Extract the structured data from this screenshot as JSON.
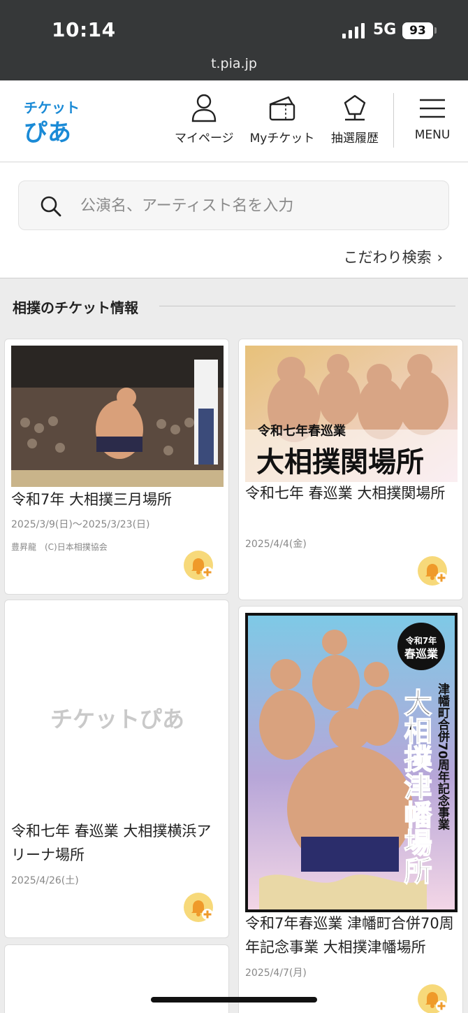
{
  "status_bar": {
    "time": "10:14",
    "network": "5G",
    "battery": "93",
    "url": "t.pia.jp"
  },
  "header": {
    "logo_line1": "チケット",
    "logo_line2": "ぴあ",
    "nav": [
      {
        "label": "マイページ",
        "icon": "person-icon"
      },
      {
        "label": "Myチケット",
        "icon": "ticket-icon"
      },
      {
        "label": "抽選履歴",
        "icon": "lottery-icon"
      },
      {
        "label": "MENU",
        "icon": "menu-icon"
      }
    ]
  },
  "search": {
    "placeholder": "公演名、アーティスト名を入力",
    "advanced_label": "こだわり検索"
  },
  "section": {
    "title": "相撲のチケット情報"
  },
  "events": [
    {
      "title": "令和7年 大相撲三月場所",
      "date": "2025/3/9(日)～2025/3/23(日)",
      "credit": "豊昇龍　(C)日本相撲協会"
    },
    {
      "title": "令和七年 春巡業 大相撲関場所",
      "date": "2025/4/4(金)",
      "banner_small": "令和七年春巡業",
      "banner_large": "大相撲関場所"
    },
    {
      "title": "令和七年 春巡業 大相撲横浜アリーナ場所",
      "date": "2025/4/26(土)",
      "placeholder_logo": "チケットぴあ"
    },
    {
      "title": "令和7年春巡業 津幡町合併70周年記念事業 大相撲津幡場所",
      "date": "2025/4/7(月)",
      "poster_badge_line1": "令和7年",
      "poster_badge_line2": "春巡業",
      "poster_vertical_sub": "津幡町合併70周年記念事業",
      "poster_vertical_main": "大相撲津幡場所"
    }
  ],
  "colors": {
    "brand_blue": "#1a8ad6",
    "status_bar": "#363839",
    "fav_orange": "#f7b733"
  }
}
